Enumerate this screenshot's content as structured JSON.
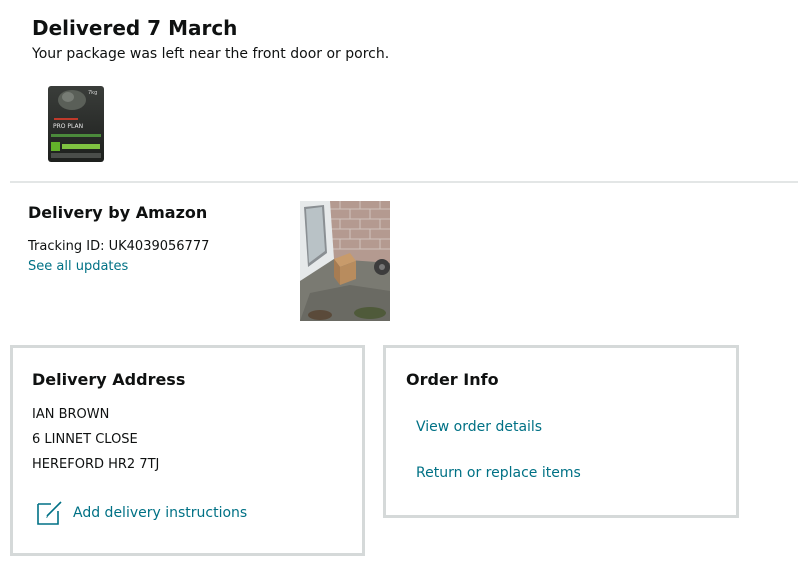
{
  "status": {
    "title": "Delivered 7 March",
    "subtitle": "Your package was left near the front door or porch."
  },
  "product": {
    "thumbnail_icon": "pet-food-bag-image",
    "bag_weight_label": "7kg",
    "bag_brand_label": "PRO PLAN"
  },
  "carrier": {
    "title": "Delivery by Amazon",
    "tracking_label": "Tracking ID: UK4039056777",
    "see_updates_label": "See all updates",
    "photo_icon": "delivery-photo-image"
  },
  "address": {
    "title": "Delivery Address",
    "lines": [
      "IAN BROWN",
      "6 LINNET CLOSE",
      "HEREFORD HR2 7TJ"
    ],
    "instructions_label": "Add delivery instructions",
    "instructions_icon": "edit-note-icon"
  },
  "order_info": {
    "title": "Order Info",
    "view_details_label": "View order details",
    "return_label": "Return or replace items"
  },
  "colors": {
    "link": "#007185",
    "text": "#0f1111",
    "border": "#d5d9d9"
  }
}
